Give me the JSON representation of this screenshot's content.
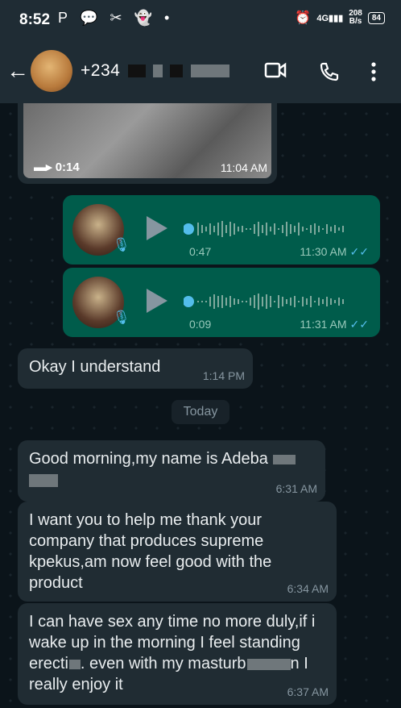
{
  "status_bar": {
    "time": "8:52",
    "icons": [
      "P",
      "💬",
      "✂",
      "👻",
      "•"
    ],
    "network": "4G",
    "speed_value": "208",
    "speed_unit": "B/s",
    "battery": "84"
  },
  "header": {
    "contact_name": "+234"
  },
  "messages": {
    "video": {
      "duration": "0:14",
      "time": "11:04 AM"
    },
    "voice1": {
      "duration": "0:47",
      "time": "11:30 AM",
      "ticks": "✓✓"
    },
    "voice2": {
      "duration": "0:09",
      "time": "11:31 AM",
      "ticks": "✓✓"
    },
    "m1": {
      "text": "Okay I understand",
      "time": "1:14 PM"
    },
    "date_separator": "Today",
    "m2": {
      "text": "Good morning,my name is Adeba",
      "time": "6:31 AM"
    },
    "m3": {
      "text": "I want you to help me thank your company that produces supreme kpekus,am now feel good with the product",
      "time": "6:34 AM"
    },
    "m4": {
      "text_a": "I can have sex any time no more duly,if i wake up in the morning I feel standing erecti",
      "text_b": ". even with my masturb",
      "text_c": "n I really enjoy it",
      "time": "6:37 AM"
    }
  }
}
